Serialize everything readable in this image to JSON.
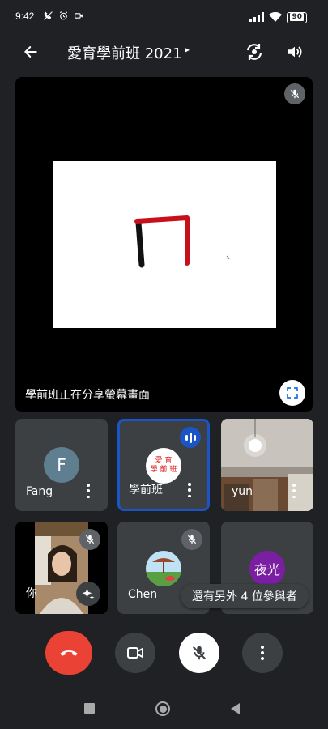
{
  "status_bar": {
    "time": "9:42",
    "battery": "90"
  },
  "header": {
    "meeting_title": "愛育學前班 2021",
    "caret": "▸"
  },
  "share": {
    "caption": "學前班正在分享螢幕畫面",
    "drawn_character": "ㄇ"
  },
  "participants": [
    {
      "name": "Fang",
      "avatar_letter": "F",
      "avatar_color": "#5f7f91"
    },
    {
      "name": "學前班",
      "avatar_text_line1": "愛 育",
      "avatar_text_line2": "學 前 班",
      "speaking": true
    },
    {
      "name": "yun"
    },
    {
      "name": "你"
    },
    {
      "name": "Chen",
      "muted": true
    },
    {
      "avatar_text": "夜光",
      "avatar_color": "#7b1fa2"
    }
  ],
  "more_participants": "還有另外 4 位參與者",
  "colors": {
    "accent_blue": "#1a54c7",
    "end_call_red": "#ea4335",
    "tile_bg": "#3c4043",
    "page_bg": "#1f2124"
  }
}
